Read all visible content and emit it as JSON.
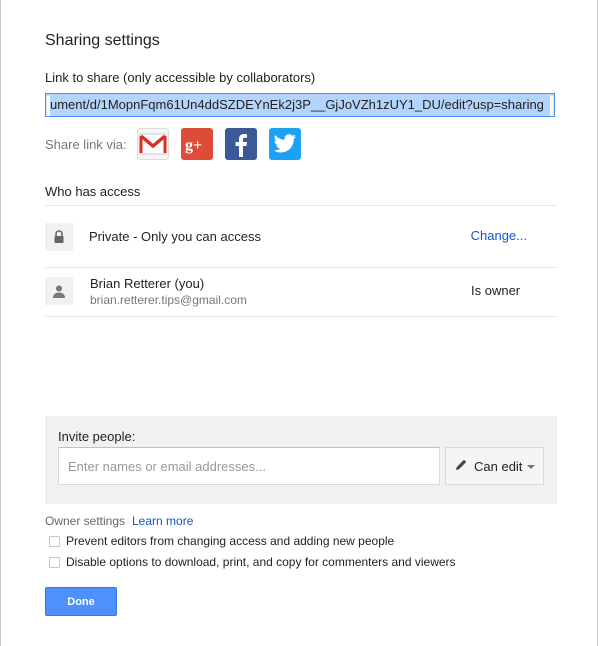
{
  "dialog": {
    "title": "Sharing settings",
    "link_label": "Link to share (only accessible by collaborators)",
    "link_value": "ument/d/1MopnFqm61Un4ddSZDEYnEk2j3P__GjJoVZh1zUY1_DU/edit?usp=sharing",
    "share_via_label": "Share link via:",
    "social": [
      {
        "name": "gmail-icon"
      },
      {
        "name": "google-plus-icon"
      },
      {
        "name": "facebook-icon"
      },
      {
        "name": "twitter-icon"
      }
    ]
  },
  "access": {
    "label": "Who has access",
    "rows": [
      {
        "icon": "lock-icon",
        "text": "Private - Only you can access",
        "action": "Change..."
      },
      {
        "icon": "person-icon",
        "name": "Brian Retterer (you)",
        "email": "brian.retterer.tips@gmail.com",
        "role": "Is owner"
      }
    ]
  },
  "invite": {
    "label": "Invite people:",
    "placeholder": "Enter names or email addresses...",
    "permission": "Can edit"
  },
  "owner_settings": {
    "label": "Owner settings",
    "learn_more": "Learn more",
    "options": [
      {
        "label": "Prevent editors from changing access and adding new people",
        "checked": false
      },
      {
        "label": "Disable options to download, print, and copy for commenters and viewers",
        "checked": false
      }
    ]
  },
  "buttons": {
    "done": "Done"
  },
  "colors": {
    "accent": "#4d90fe",
    "link": "#1155cc"
  }
}
